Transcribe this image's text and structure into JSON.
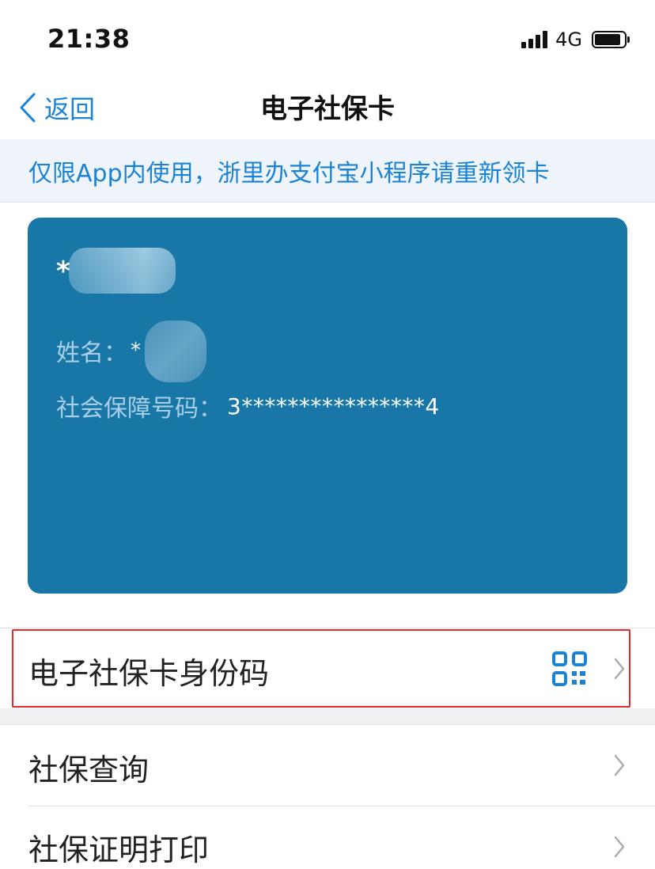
{
  "status_bar": {
    "time": "21:38",
    "network": "4G"
  },
  "nav": {
    "back_label": "返回",
    "title": "电子社保卡"
  },
  "notice": {
    "text": "仅限App内使用，浙里办支付宝小程序请重新领卡"
  },
  "card": {
    "id_mask": "*",
    "name_label": "姓名：",
    "name_value": "*",
    "ssn_label": "社会保障号码：",
    "ssn_value": "3****************4",
    "background_color": "#1877a6"
  },
  "menu": {
    "items": [
      {
        "label": "电子社保卡身份码",
        "icon": "qr-code-icon",
        "highlighted": true
      },
      {
        "label": "社保查询"
      },
      {
        "label": "社保证明打印"
      }
    ]
  },
  "colors": {
    "accent": "#1a83d6",
    "highlight_border": "#e0282e"
  }
}
